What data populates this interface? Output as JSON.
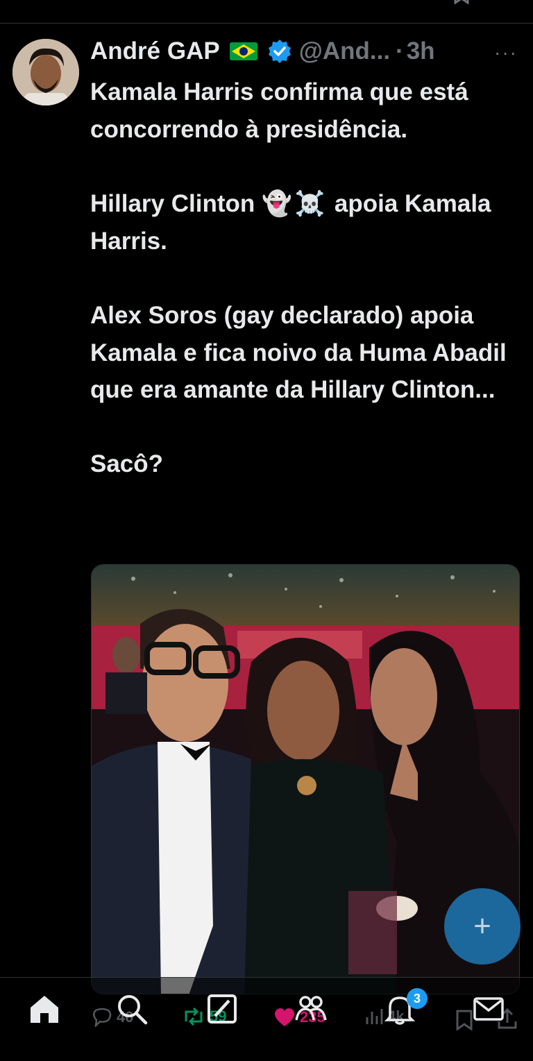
{
  "tweet": {
    "author_name": "André GAP",
    "handle": "@And...",
    "separator": "·",
    "time": "3h",
    "more_label": "···",
    "paragraphs": [
      "Kamala Harris confirma que está concorrendo à presidência.",
      "Alex Soros (gay declarado) apoia Kamala e fica noivo da Huma Abadil que era amante da  Hillary Clinton...",
      "Sacô?"
    ],
    "p2": {
      "before": "Hillary Clinton ",
      "emoji": "👻☠️",
      "after": " apoia Kamala Harris."
    }
  },
  "actions": {
    "replies": "40",
    "retweets": "59",
    "likes": "235",
    "views": "4k"
  },
  "nav": {
    "notifications_badge": "3"
  },
  "colors": {
    "background": "#000000",
    "text": "#e7e9ea",
    "muted": "#71767b",
    "verified": "#1d9bf0",
    "like": "#f91880",
    "retweet": "#00ba7c",
    "fab": "#1d6fa8"
  }
}
